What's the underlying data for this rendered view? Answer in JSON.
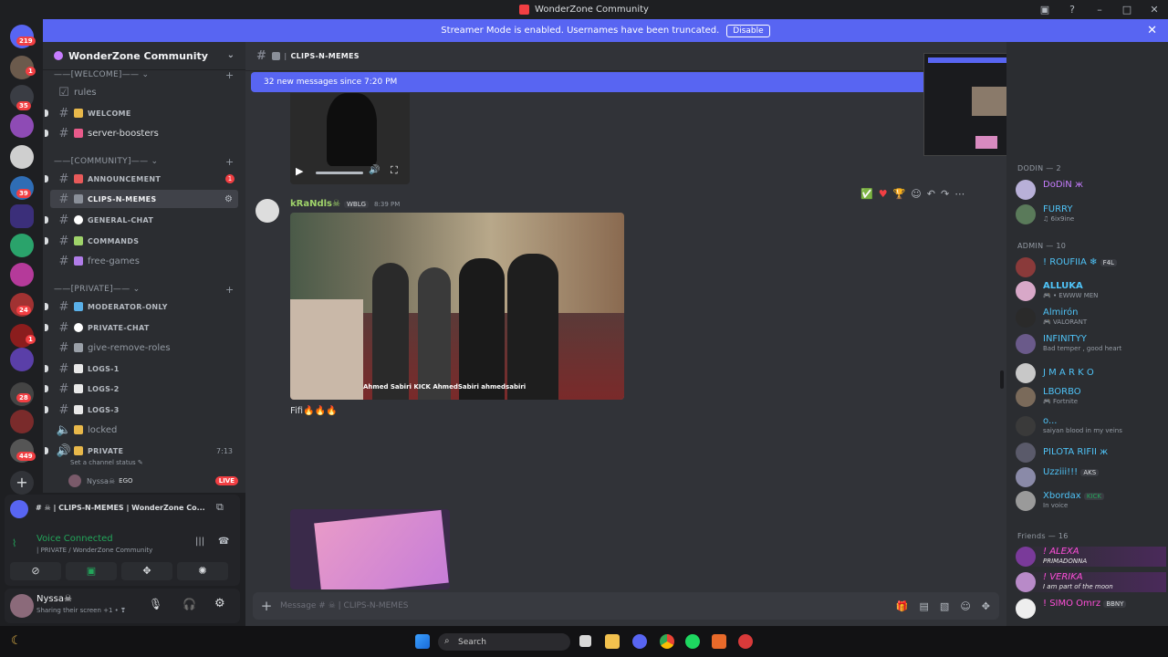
{
  "window": {
    "title": "WonderZone Community"
  },
  "banner": {
    "text": "Streamer Mode is enabled. Usernames have been truncated.",
    "button": "Disable"
  },
  "guild_badges": [
    "219",
    "1",
    "35",
    "39",
    "24",
    "1",
    "28",
    "449"
  ],
  "server": {
    "name": "WonderZone Community"
  },
  "categories": {
    "welcome": "——[WELCOME]—— ⌄",
    "community": "——[COMMUNITY]—— ⌄",
    "private": "——[PRIVATE]—— ⌄"
  },
  "channels": {
    "rules": "rules",
    "welcome": "WELCOME",
    "boosters": "server-boosters",
    "announcement": "ANNOUNCEMENT",
    "announcement_badge": "1",
    "clips": "CLIPS-N-MEMES",
    "general": "GENERAL-CHAT",
    "commands": "COMMANDS",
    "freegames": "free-games",
    "modonly": "MODERATOR-ONLY",
    "privchat": "PRIVATE-CHAT",
    "giveremove": "give-remove-roles",
    "logs1": "LOGS-1",
    "logs2": "LOGS-2",
    "logs3": "LOGS-3",
    "locked": "locked",
    "private_voice": "PRIVATE",
    "private_time": "7:13",
    "set_status": "Set a channel status ✎",
    "voice_user": "Nyssa☠",
    "voice_user_tag": "EGO",
    "live": "LIVE"
  },
  "voice_panel": {
    "stream_title": "# ☠ | CLIPS-N-MEMES | WonderZone Co...",
    "connected": "Voice Connected",
    "location": "| PRIVATE / WonderZone Community"
  },
  "user_panel": {
    "name": "Nyssa☠",
    "status": "Sharing their screen +1 • ❣"
  },
  "chat": {
    "channel": "CLIPS-N-MEMES",
    "new_messages": "32 new messages since 7:20 PM",
    "author": "kRaNdls☠",
    "author_tag": "WBLG",
    "timestamp": "8:39 PM",
    "message": "Fifi",
    "watermark": "Ahmed Sabiri  KICK AhmedSabiri  ahmedsabiri",
    "composer_placeholder": "Message # ☠ | CLIPS-N-MEMES"
  },
  "members": {
    "dodin_header": "DODIN — 2",
    "admin_header": "ADMIN — 10",
    "friends_header": "Friends — 16",
    "dodin": [
      {
        "name": "DoDiN ж",
        "status": "",
        "color": "#c77dff"
      },
      {
        "name": "FURRY",
        "status": "♫ 6ix9ine",
        "color": "#4fc3f7"
      }
    ],
    "admin": [
      {
        "name": "! ROUFIIA ❄",
        "tag": "F4L",
        "status": "",
        "color": "#4fc3f7"
      },
      {
        "name": "ALLUKA",
        "status": "🎮 • EWWW MEN",
        "color": "#4fc3f7"
      },
      {
        "name": "Almirón",
        "status": "🎮 VALORANT",
        "color": "#4fc3f7"
      },
      {
        "name": "INFINITYY",
        "status": "Bad temper , good heart",
        "color": "#4fc3f7"
      },
      {
        "name": "J M A R K O",
        "status": "",
        "color": "#4fc3f7"
      },
      {
        "name": "LBORBO",
        "status": "🎮 Fortnite",
        "color": "#4fc3f7"
      },
      {
        "name": "o...",
        "status": "saiyan blood in my veins",
        "color": "#4fc3f7"
      },
      {
        "name": "PILOTA RIFII ж",
        "status": "",
        "color": "#4fc3f7"
      },
      {
        "name": "Uzziii!!!",
        "tag": "AKS",
        "status": "",
        "color": "#4fc3f7"
      },
      {
        "name": "Xbordax",
        "tag": "KICK",
        "status": "In voice",
        "color": "#4fc3f7"
      }
    ],
    "friends": [
      {
        "name": "! ALEXA",
        "status": "PRIMADONNA",
        "color": "#ff4fd8"
      },
      {
        "name": "! VERIKA",
        "status": "I am part of the moon",
        "color": "#ff4fd8"
      },
      {
        "name": "! SIMO Omrz",
        "tag": "BBNY",
        "status": "",
        "color": "#ff4fd8"
      }
    ]
  },
  "taskbar": {
    "search": "Search"
  },
  "colors": {
    "accent": "#5865f2",
    "live": "#f23f43",
    "voice": "#23a55a"
  }
}
